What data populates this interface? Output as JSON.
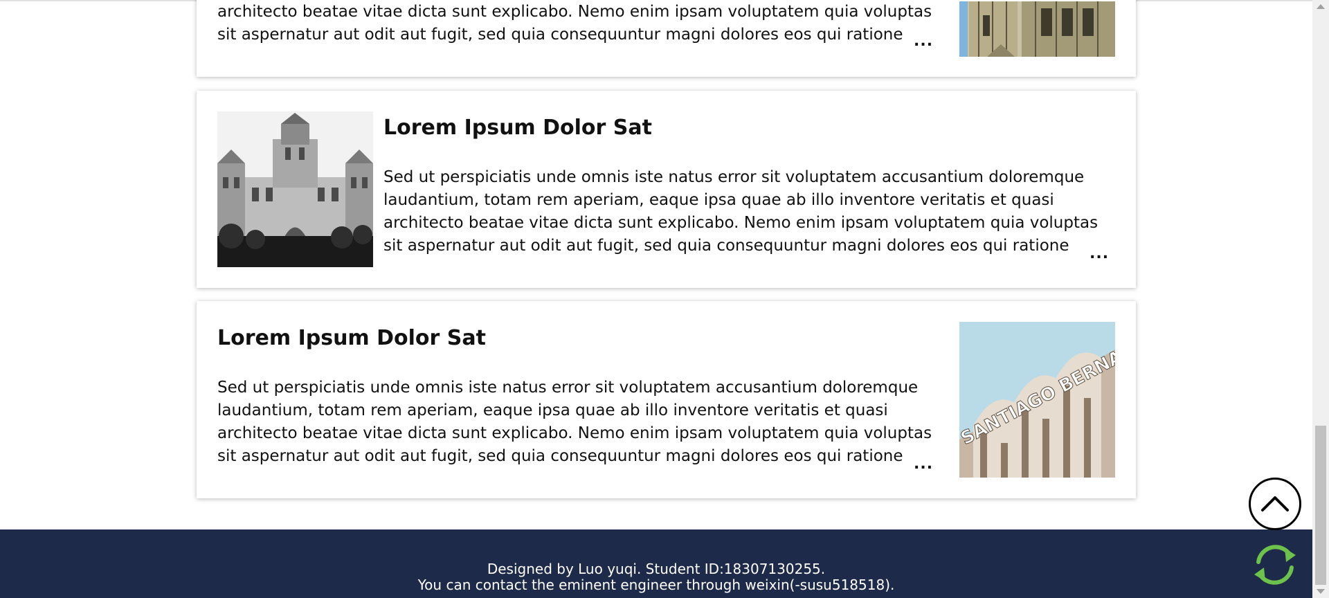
{
  "cards": [
    {
      "text_tail": "architecto beatae vitae dicta sunt explicabo. Nemo enim ipsam voluptatem quia voluptas sit aspernatur aut odit aut fugit, sed quia consequuntur magni dolores eos qui ratione",
      "more": "..."
    },
    {
      "title": "Lorem Ipsum Dolor Sat",
      "text": "Sed ut perspiciatis unde omnis iste natus error sit voluptatem accusantium doloremque laudantium, totam rem aperiam, eaque ipsa quae ab illo inventore veritatis et quasi architecto beatae vitae dicta sunt explicabo. Nemo enim ipsam voluptatem quia voluptas sit aspernatur aut odit aut fugit, sed quia consequuntur magni dolores eos qui ratione",
      "more": "..."
    },
    {
      "title": "Lorem Ipsum Dolor Sat",
      "text": "Sed ut perspiciatis unde omnis iste natus error sit voluptatem accusantium doloremque laudantium, totam rem aperiam, eaque ipsa quae ab illo inventore veritatis et quasi architecto beatae vitae dicta sunt explicabo. Nemo enim ipsam voluptatem quia voluptas sit aspernatur aut odit aut fugit, sed quia consequuntur magni dolores eos qui ratione",
      "more": "...",
      "photo_sign": "SANTIAGO BERNA"
    }
  ],
  "footer": {
    "line1": "Designed by Luo yuqi. Student ID:18307130255.",
    "line2": "You can contact the eminent engineer through weixin(-susu518518)."
  },
  "icons": {
    "back_to_top": "chevron-up-circle-icon",
    "refresh": "refresh-cycle-icon"
  },
  "colors": {
    "footer_bg": "#1e2a4a",
    "refresh_green": "#6cc24a"
  }
}
